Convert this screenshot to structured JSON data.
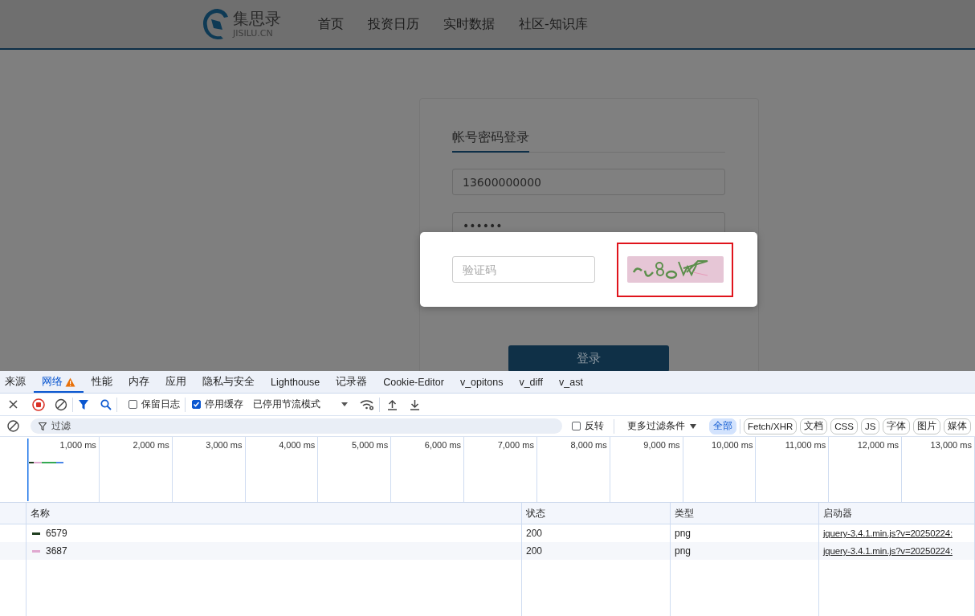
{
  "site": {
    "logo": {
      "name": "集思录",
      "domain": "JISILU.CN"
    },
    "nav": [
      "首页",
      "投资日历",
      "实时数据",
      "社区-知识库"
    ],
    "login": {
      "tab": "帐号密码登录",
      "phone": "13600000000",
      "password": "••••••",
      "submit": "登录"
    },
    "captcha_dialog": {
      "placeholder": "验证码"
    }
  },
  "devtools": {
    "tabs": [
      {
        "label": "来源",
        "selected": false,
        "warning": false
      },
      {
        "label": "网络",
        "selected": true,
        "warning": true
      },
      {
        "label": "性能",
        "selected": false,
        "warning": false
      },
      {
        "label": "内存",
        "selected": false,
        "warning": false
      },
      {
        "label": "应用",
        "selected": false,
        "warning": false
      },
      {
        "label": "隐私与安全",
        "selected": false,
        "warning": false
      },
      {
        "label": "Lighthouse",
        "selected": false,
        "warning": false
      },
      {
        "label": "记录器",
        "selected": false,
        "warning": false
      },
      {
        "label": "Cookie-Editor",
        "selected": false,
        "warning": false
      },
      {
        "label": "v_opitons",
        "selected": false,
        "warning": false
      },
      {
        "label": "v_diff",
        "selected": false,
        "warning": false
      },
      {
        "label": "v_ast",
        "selected": false,
        "warning": false
      }
    ],
    "toolbar": {
      "preserve_log": {
        "label": "保留日志",
        "checked": false
      },
      "disable_cache": {
        "label": "停用缓存",
        "checked": true
      },
      "throttling": "已停用节流模式"
    },
    "filter": {
      "placeholder": "过滤",
      "invert": {
        "label": "反转",
        "checked": false
      },
      "more_filters": "更多过滤条件",
      "types": [
        {
          "label": "全部",
          "selected": true
        },
        {
          "label": "Fetch/XHR",
          "selected": false
        },
        {
          "label": "文档",
          "selected": false
        },
        {
          "label": "CSS",
          "selected": false
        },
        {
          "label": "JS",
          "selected": false
        },
        {
          "label": "字体",
          "selected": false
        },
        {
          "label": "图片",
          "selected": false
        },
        {
          "label": "媒体",
          "selected": false
        }
      ]
    },
    "timeline": {
      "ticks": [
        "1,000 ms",
        "2,000 ms",
        "3,000 ms",
        "4,000 ms",
        "5,000 ms",
        "6,000 ms",
        "7,000 ms",
        "8,000 ms",
        "9,000 ms",
        "10,000 ms",
        "11,000 ms",
        "12,000 ms",
        "13,000 ms"
      ]
    },
    "table": {
      "columns": [
        "名称",
        "状态",
        "类型",
        "启动器"
      ],
      "rows": [
        {
          "name": "6579",
          "color": "#1f3d1f",
          "status": "200",
          "type": "png",
          "initiator": "jquery-3.4.1.min.js?v=20250224:"
        },
        {
          "name": "3687",
          "color": "#e0a8d0",
          "status": "200",
          "type": "png",
          "initiator": "jquery-3.4.1.min.js?v=20250224:"
        }
      ]
    }
  }
}
